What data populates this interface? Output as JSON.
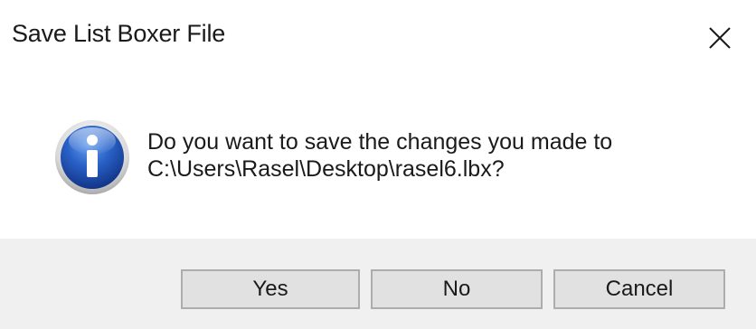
{
  "window": {
    "title": "Save List Boxer File",
    "close_icon": "close-icon"
  },
  "message": {
    "icon": "info-icon",
    "line1": "Do you want to save the changes you made to",
    "line2": "C:\\Users\\Rasel\\Desktop\\rasel6.lbx?"
  },
  "buttons": {
    "yes": "Yes",
    "no": "No",
    "cancel": "Cancel"
  },
  "colors": {
    "footer_bg": "#f0f0f0",
    "button_bg": "#e1e1e1",
    "button_border": "#adadad",
    "icon_blue": "#1f4fa8"
  }
}
